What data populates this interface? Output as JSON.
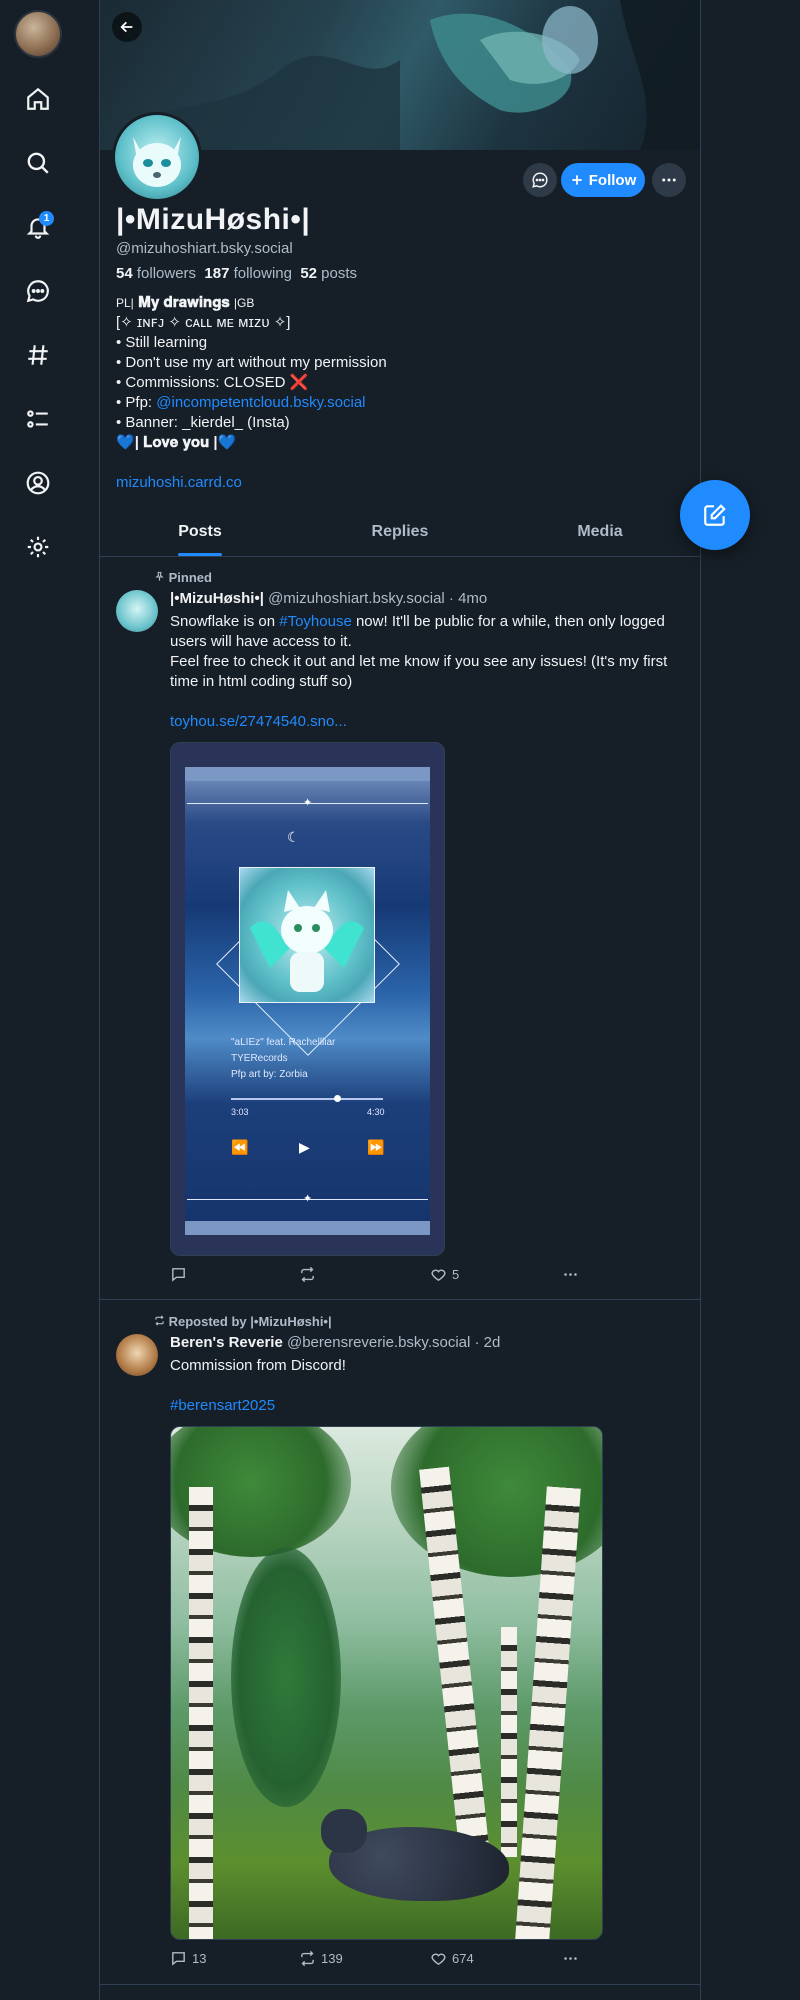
{
  "nav": {
    "items": [
      "home-icon",
      "search-icon",
      "bell-icon",
      "chat-icon",
      "hashtag-icon",
      "list-icon",
      "profile-icon",
      "gear-icon"
    ],
    "notifications_badge": "1"
  },
  "profile": {
    "display_name": "|•MizuHøshi•|",
    "handle": "@mizuhoshiart.bsky.social",
    "followers_count": "54",
    "followers_label": "followers",
    "following_count": "187",
    "following_label": "following",
    "posts_count": "52",
    "posts_label": "posts",
    "follow_label": "Follow",
    "bio": {
      "line1_prefix": "PL|",
      "line1_main": " 𝐌𝐲 𝐝𝐫𝐚𝐰𝐢𝐧𝐠𝐬 ",
      "line1_suffix": "|GB",
      "line2": "[✧ ɪɴꜰᴊ ✧ ᴄᴀʟʟ ᴍᴇ ᴍɪᴢᴜ ✧]",
      "line3": "• Still learning",
      "line4": "• Don't use my art without my permission",
      "line5": "• Commissions: CLOSED ",
      "line5_icon": "❌",
      "line6_prefix": "• Pfp: ",
      "line6_link": "@incompetentcloud.bsky.social",
      "line7": "• Banner: _kierdel_ (Insta)",
      "line8_heart": "💙",
      "line8_text": "| 𝐋𝐨𝐯𝐞 𝐲𝐨𝐮 |"
    },
    "website": "mizuhoshi.carrd.co"
  },
  "tabs": [
    "Posts",
    "Replies",
    "Media"
  ],
  "posts": [
    {
      "context": "Pinned",
      "author": "|•MizuHøshi•|",
      "handle": "@mizuhoshiart.bsky.social",
      "time": "· 4mo",
      "text_before_tag": "Snowflake is on ",
      "tag": "#Toyhouse",
      "text_after_tag": " now! It'll be public for a while, then only logged users will have access to it.",
      "text_line2": "Feel free to check it out and let me know if you see any issues! (It's my first time in html coding stuff so)",
      "link": "toyhou.se/27474540.sno...",
      "media_text": {
        "song": "\"aLIEz\" feat. Rachellliar",
        "label": "TYERecords",
        "credit": "Pfp art by: Zorbia",
        "time_start": "3:03",
        "time_end": "4:30"
      },
      "replies": "",
      "reposts": "",
      "likes": "5"
    },
    {
      "context": "Reposted by |•MizuHøshi•|",
      "author": "Beren's Reverie",
      "handle": "@berensreverie.bsky.social",
      "time": "· 2d",
      "text": "Commission from Discord!",
      "tag": "#berensart2025",
      "replies": "13",
      "reposts": "139",
      "likes": "674"
    }
  ],
  "colors": {
    "accent": "#208bfe",
    "background": "#161e27",
    "border": "#2e4052",
    "muted": "#aebbc9"
  }
}
